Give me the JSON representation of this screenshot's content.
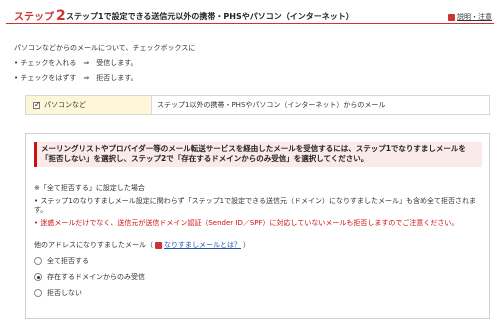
{
  "header": {
    "step_prefix": "ステップ",
    "step_number": "2",
    "title": "ステップ1で設定できる送信元以外の携帯・PHSやパソコン（インターネット）",
    "help_link": "説明・注意"
  },
  "intro": {
    "line1": "パソコンなどからのメールについて、チェックボックスに",
    "bullet1": "チェックを入れる　⇒　受信します。",
    "bullet2": "チェックをはずす　⇒　拒否します。"
  },
  "mini_table": {
    "checkbox_label": "パソコンなど",
    "checkbox_checked": true,
    "description": "ステップ1以外の携帯・PHSやパソコン（インターネット）からのメール"
  },
  "notice": {
    "text": "メーリングリストやプロバイダー等のメール転送サービスを経由したメールを受信するには、ステップ1でなりすましメールを「拒否しない」を選択し、ステップ2で「存在するドメインからのみ受信」を選択してください。"
  },
  "notes": {
    "heading": "※「全て拒否する」に設定した場合",
    "note1": "• ステップ1のなりすましメール設定に関わらず「ステップ1で設定できる送信元（ドメイン）になりすましたメール」も含め全て拒否されます。",
    "note2": "• 迷惑メールだけでなく、送信元が送信ドメイン認証（Sender ID／SPF）に対応していないメールも拒否しますのでご注意ください。"
  },
  "alias": {
    "label": "他のアドレスになりすましたメール（",
    "link": "なりすましメールとは？",
    "label_end": "）"
  },
  "radios": [
    {
      "label": "全て拒否する",
      "selected": false
    },
    {
      "label": "存在するドメインからのみ受信",
      "selected": true
    },
    {
      "label": "拒否しない",
      "selected": false
    }
  ]
}
